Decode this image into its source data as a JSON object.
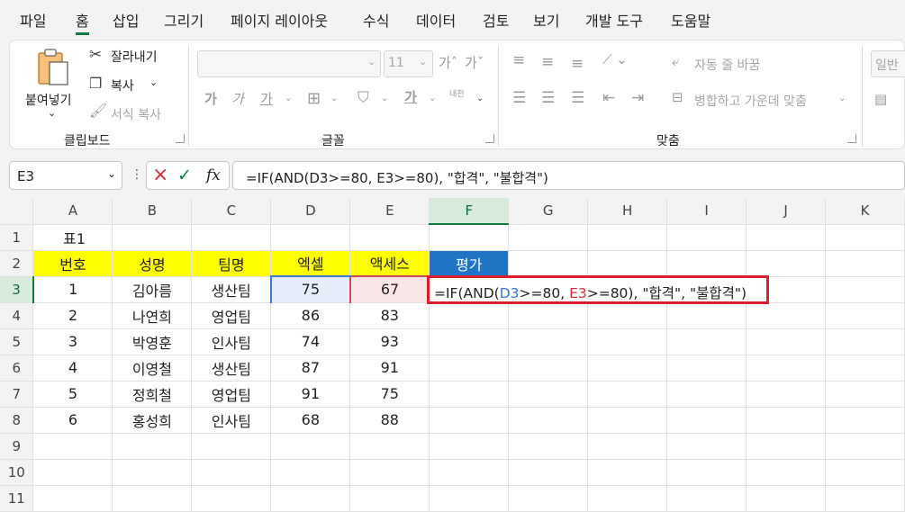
{
  "menu": [
    "파일",
    "홈",
    "삽입",
    "그리기",
    "페이지 레이아웃",
    "수식",
    "데이터",
    "검토",
    "보기",
    "개발 도구",
    "도움말"
  ],
  "ribbon": {
    "clipboard": {
      "paste": "붙여넣기",
      "cut": "잘라내기",
      "copy": "복사",
      "format_painter": "서식 복사",
      "label": "클립보드"
    },
    "font": {
      "font_size": "11",
      "bold": "가",
      "italic": "가",
      "underline": "가",
      "font_color": "가",
      "phonetic": "내천",
      "label": "글꼴"
    },
    "alignment": {
      "wrap_text": "자동 줄 바꿈",
      "merge_center": "병합하고 가운데 맞춤",
      "label": "맞춤"
    },
    "number": {
      "format": "일반"
    }
  },
  "formula_bar": {
    "name_box": "E3",
    "cancel_icon": "×",
    "enter_icon": "✓",
    "fx_label": "fx",
    "formula": "=IF(AND(D3>=80, E3>=80), \"합격\", \"불합격\")"
  },
  "grid": {
    "columns": [
      "A",
      "B",
      "C",
      "D",
      "E",
      "F",
      "G",
      "H",
      "I",
      "J",
      "K"
    ],
    "rows": [
      "1",
      "2",
      "3",
      "4",
      "5",
      "6",
      "7",
      "8",
      "9",
      "10",
      "11"
    ],
    "title_cell": "표1",
    "headers": [
      "번호",
      "성명",
      "팀명",
      "엑셀",
      "액세스",
      "평가"
    ],
    "records": [
      [
        "1",
        "김아름",
        "생산팀",
        "75",
        "67"
      ],
      [
        "2",
        "나연희",
        "영업팀",
        "86",
        "83"
      ],
      [
        "3",
        "박영훈",
        "인사팀",
        "74",
        "93"
      ],
      [
        "4",
        "이영철",
        "생산팀",
        "87",
        "91"
      ],
      [
        "5",
        "정희철",
        "영업팀",
        "91",
        "75"
      ],
      [
        "6",
        "홍성희",
        "인사팀",
        "68",
        "88"
      ]
    ],
    "active_cell_formula": {
      "prefix": "=IF(AND(",
      "ref1": "D3",
      "mid1": ">=80, ",
      "ref2": "E3",
      "suffix": ">=80), \"합격\", \"불합격\")"
    }
  },
  "colors": {
    "header_yellow": "#ffff00",
    "header_blue": "#1f74c6",
    "accent_green": "#107c41",
    "highlight_red": "#d9202c"
  }
}
